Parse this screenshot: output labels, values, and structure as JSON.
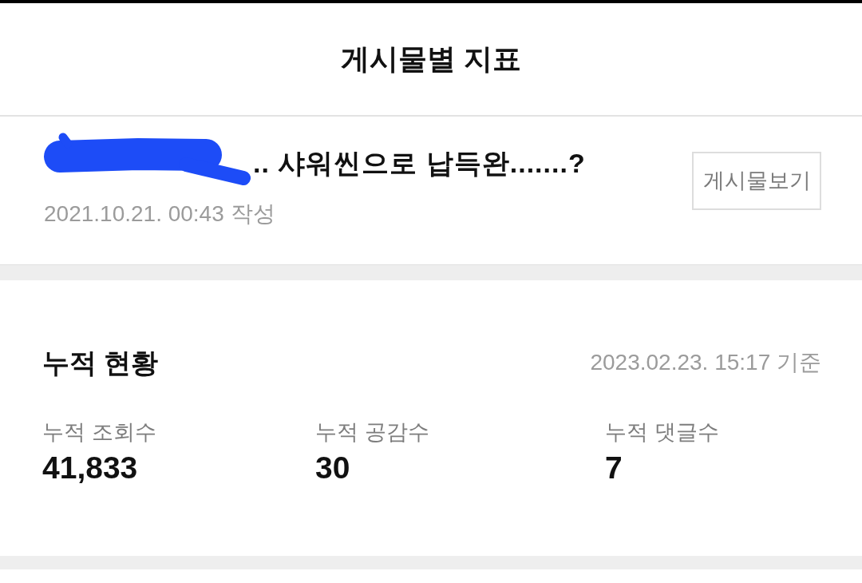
{
  "header": {
    "title": "게시물별 지표"
  },
  "post": {
    "redacted": true,
    "title": ".. 샤워씬으로 납득완.......?",
    "date": "2021.10.21. 00:43 작성",
    "view_button": "게시물보기"
  },
  "cumulative": {
    "title": "누적 현황",
    "as_of": "2023.02.23. 15:17 기준",
    "stats": [
      {
        "label": "누적 조회수",
        "value": "41,833"
      },
      {
        "label": "누적 공감수",
        "value": "30"
      },
      {
        "label": "누적 댓글수",
        "value": "7"
      }
    ]
  }
}
